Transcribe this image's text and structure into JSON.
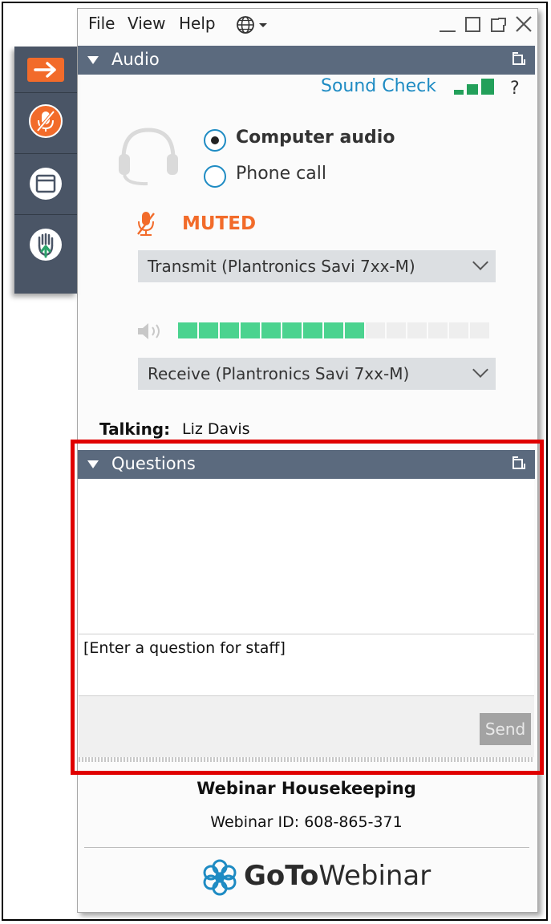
{
  "menu": {
    "file": "File",
    "view": "View",
    "help": "Help"
  },
  "audio_panel": {
    "title": "Audio",
    "sound_check": "Sound Check",
    "help_mark": "?",
    "computer_audio": "Computer audio",
    "phone_call": "Phone call",
    "selected_option": "computer_audio",
    "muted_label": "MUTED",
    "transmit_device": "Transmit (Plantronics Savi 7xx-M)",
    "receive_device": "Receive (Plantronics Savi 7xx-M)",
    "volume_level": 0.6,
    "talking_label": "Talking:",
    "talking_name": "Liz Davis"
  },
  "questions_panel": {
    "title": "Questions",
    "input_placeholder": "[Enter a question for staff]",
    "send_label": "Send"
  },
  "footer": {
    "webinar_title": "Webinar Housekeeping",
    "webinar_id": "Webinar ID: 608-865-371",
    "brand_goto": "GoTo",
    "brand_webinar": "Webinar"
  },
  "colors": {
    "accent_orange": "#f26b2a",
    "panel_header": "#5b6a7e",
    "meter_green": "#4bd38f",
    "link_blue": "#1e8bc3",
    "highlight_red": "#e00000"
  }
}
